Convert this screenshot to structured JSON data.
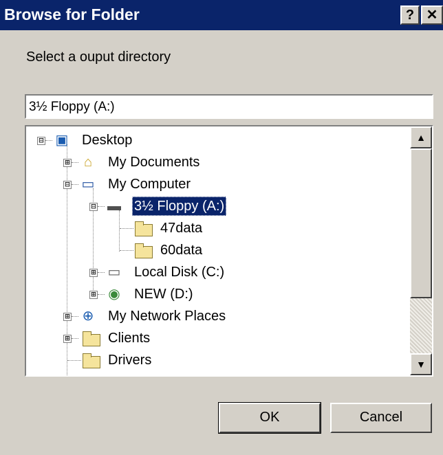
{
  "window": {
    "title": "Browse for Folder",
    "help_label": "?",
    "close_label": "✕"
  },
  "prompt": "Select a ouput directory",
  "path_value": "3½ Floppy (A:)",
  "tree": {
    "items": [
      {
        "label": "Desktop",
        "icon": "desktop-icon",
        "expander": "⊟"
      },
      {
        "label": "My Documents",
        "icon": "my-documents-icon",
        "expander": "⊞"
      },
      {
        "label": "My Computer",
        "icon": "my-computer-icon",
        "expander": "⊟"
      },
      {
        "label": "3½ Floppy (A:)",
        "icon": "floppy-drive-icon",
        "expander": "⊟",
        "selected": true
      },
      {
        "label": "47data",
        "icon": "folder-icon"
      },
      {
        "label": "60data",
        "icon": "folder-icon"
      },
      {
        "label": "Local Disk (C:)",
        "icon": "hard-disk-icon",
        "expander": "⊞"
      },
      {
        "label": "NEW (D:)",
        "icon": "cd-drive-icon",
        "expander": "⊞"
      },
      {
        "label": "My Network Places",
        "icon": "network-places-icon",
        "expander": "⊞"
      },
      {
        "label": "Clients",
        "icon": "folder-icon",
        "expander": "⊞"
      },
      {
        "label": "Drivers",
        "icon": "folder-icon"
      }
    ]
  },
  "scrollbar": {
    "up": "▲",
    "down": "▼"
  },
  "buttons": {
    "ok": "OK",
    "cancel": "Cancel"
  }
}
